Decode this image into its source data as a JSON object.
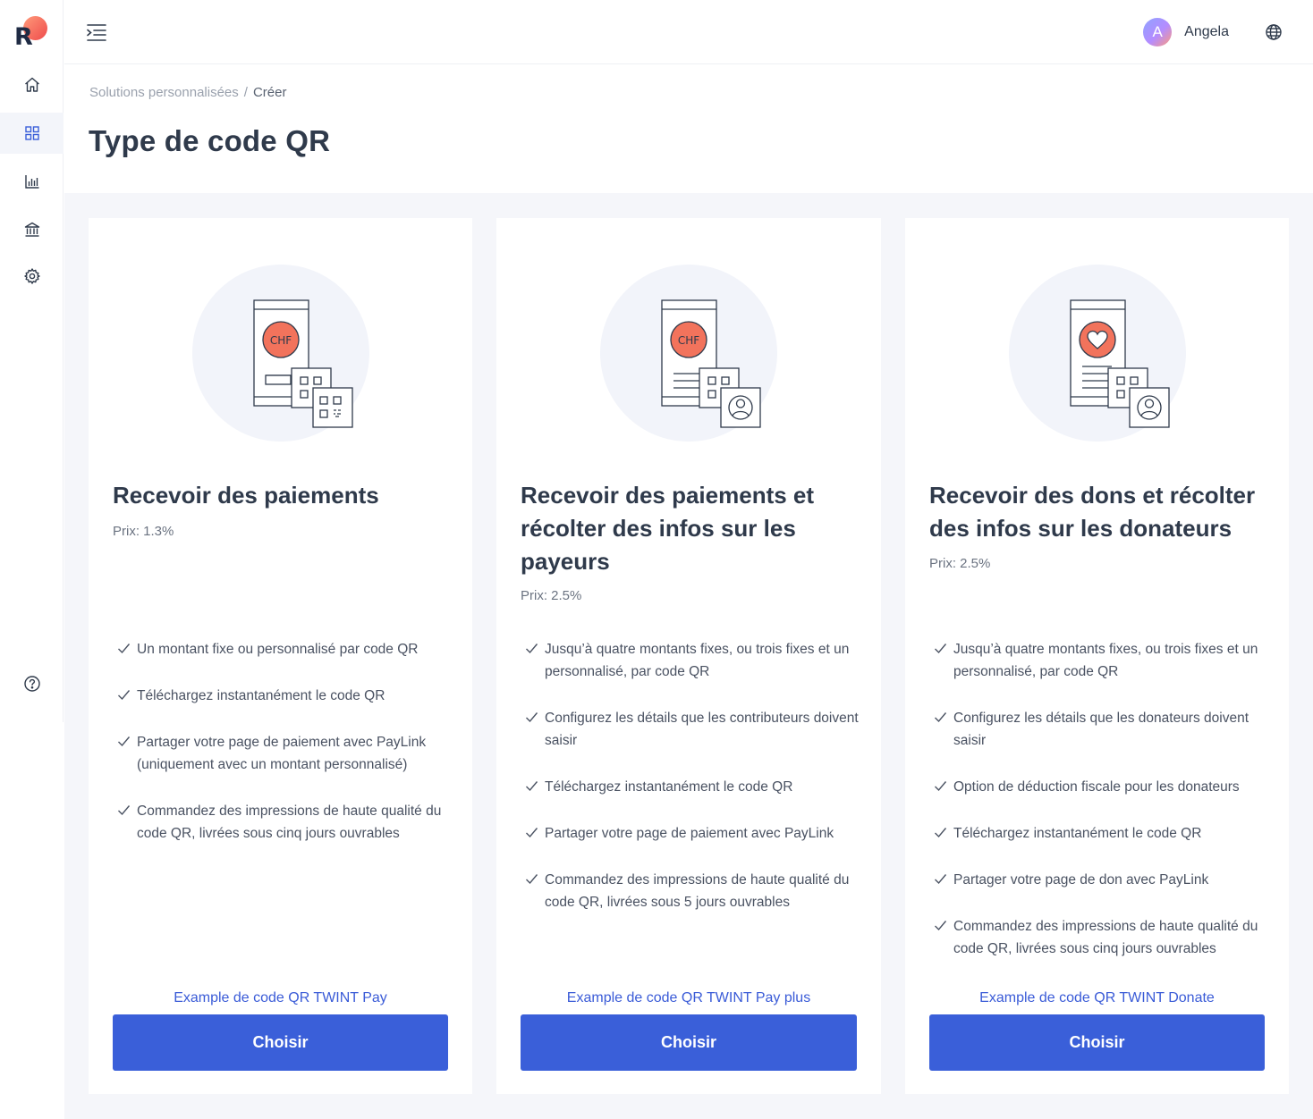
{
  "sidebar": {
    "logo_letter": "R",
    "items": [
      {
        "icon": "home-icon"
      },
      {
        "icon": "grid-icon",
        "active": true
      },
      {
        "icon": "bar-chart-icon"
      },
      {
        "icon": "bank-icon"
      },
      {
        "icon": "gear-icon"
      },
      {
        "icon": "help-icon"
      }
    ]
  },
  "topbar": {
    "avatar_initial": "A",
    "user_name": "Angela"
  },
  "breadcrumb": {
    "parent": "Solutions personnalisées",
    "separator": "/",
    "current": "Créer"
  },
  "page_title": "Type de code QR",
  "colors": {
    "accent": "#3a5fd9",
    "link": "#3a5bd7",
    "coral": "#f2735c",
    "background": "#f5f6fa"
  },
  "cards": [
    {
      "title": "Recevoir des paiements",
      "price": "Prix: 1.3%",
      "illustration": "phone-chf-qr-illustration",
      "features": [
        "Un montant fixe ou personnalisé par code QR",
        "Téléchargez instantanément le code QR",
        "Partager votre page de paiement avec PayLink (uniquement avec un montant personnalisé)",
        "Commandez des impressions de haute qualité du code QR, livrées sous cinq jours ouvrables"
      ],
      "example_link": "Example de code QR TWINT Pay",
      "button": "Choisir"
    },
    {
      "title": "Recevoir des paiements et récolter des infos sur les payeurs",
      "price": "Prix: 2.5%",
      "illustration": "phone-chf-user-illustration",
      "features": [
        "Jusqu’à quatre montants fixes, ou trois fixes et un personnalisé, par code QR",
        "Configurez les détails que les contributeurs doivent saisir",
        "Téléchargez instantanément le code QR",
        "Partager votre page de paiement avec PayLink",
        "Commandez des impressions de haute qualité du code QR, livrées sous 5 jours ouvrables"
      ],
      "example_link": "Example de code QR TWINT Pay plus",
      "button": "Choisir"
    },
    {
      "title": "Recevoir des dons et récolter des infos sur les donateurs",
      "price": "Prix: 2.5%",
      "illustration": "phone-heart-user-illustration",
      "features": [
        "Jusqu’à quatre montants fixes, ou trois fixes et un personnalisé, par code QR",
        "Configurez les détails que les donateurs doivent saisir",
        "Option de déduction fiscale pour les donateurs",
        "Téléchargez instantanément le code QR",
        "Partager votre page de don avec PayLink",
        "Commandez des impressions de haute qualité du code QR, livrées sous cinq jours ouvrables"
      ],
      "example_link": "Example de code QR TWINT Donate",
      "button": "Choisir"
    }
  ]
}
